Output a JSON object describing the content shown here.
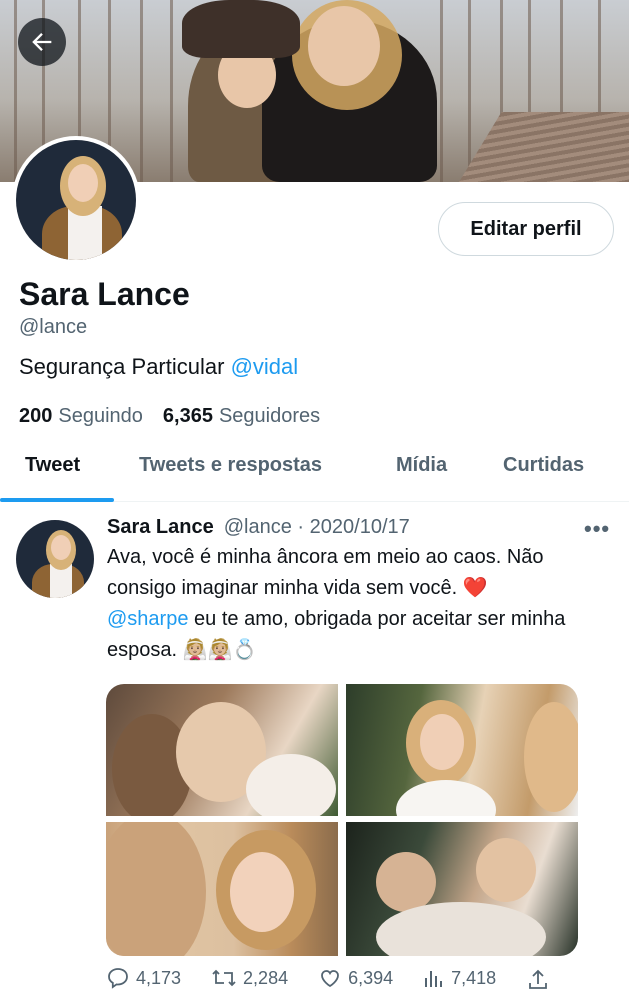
{
  "profile": {
    "name": "Sara Lance",
    "handle": "@lance",
    "bio_text": "Segurança Particular ",
    "bio_link": "@vidal",
    "following_count": "200",
    "following_label": "Seguindo",
    "followers_count": "6,365",
    "followers_label": "Seguidores",
    "edit_button": "Editar perfil"
  },
  "tabs": [
    {
      "label": "Tweet",
      "active": true
    },
    {
      "label": "Tweets e respostas",
      "active": false
    },
    {
      "label": "Mídia",
      "active": false
    },
    {
      "label": "Curtidas",
      "active": false
    }
  ],
  "tweet": {
    "author_name": "Sara Lance",
    "author_handle": "@lance",
    "separator": "·",
    "date": "2020/10/17",
    "more": "•••",
    "text_line1": "Ava, você é minha âncora em meio ao caos. Não consigo imaginar minha vida sem você. ",
    "heart": "❤️",
    "mention": "@sharpe",
    "text_line2": " eu te amo, obrigada por aceitar ser minha esposa. ",
    "emojis": "👰🏼👰🏼💍",
    "replies": "4,173",
    "retweets": "2,284",
    "likes": "6,394",
    "views": "7,418"
  },
  "icons": {
    "back": "arrow-left-icon",
    "reply": "reply-icon",
    "retweet": "retweet-icon",
    "like": "heart-icon",
    "views": "views-icon",
    "share": "share-icon"
  },
  "colors": {
    "accent": "#1d9bf0",
    "text": "#0f1419",
    "muted": "#536471"
  }
}
